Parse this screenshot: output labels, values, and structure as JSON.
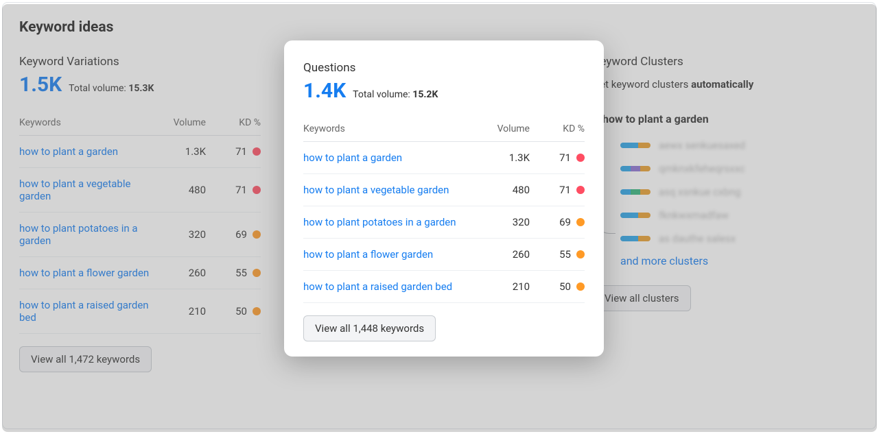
{
  "page_title": "Keyword ideas",
  "kd_colors": {
    "red": "#ff4d62",
    "orange": "#ff9a26"
  },
  "variations": {
    "title": "Keyword Variations",
    "count": "1.5K",
    "total_volume_label": "Total volume:",
    "total_volume": "15.3K",
    "headers": {
      "keywords": "Keywords",
      "volume": "Volume",
      "kd": "KD %"
    },
    "rows": [
      {
        "keyword": "how to plant a garden",
        "volume": "1.3K",
        "kd": "71",
        "kd_color": "red"
      },
      {
        "keyword": "how to plant a vegetable garden",
        "volume": "480",
        "kd": "71",
        "kd_color": "red"
      },
      {
        "keyword": "how to plant potatoes in a garden",
        "volume": "320",
        "kd": "69",
        "kd_color": "orange"
      },
      {
        "keyword": "how to plant a flower garden",
        "volume": "260",
        "kd": "55",
        "kd_color": "orange"
      },
      {
        "keyword": "how to plant a raised garden bed",
        "volume": "210",
        "kd": "50",
        "kd_color": "orange"
      }
    ],
    "button": "View all 1,472 keywords"
  },
  "questions": {
    "title": "Questions",
    "count": "1.4K",
    "total_volume_label": "Total volume:",
    "total_volume": "15.2K",
    "headers": {
      "keywords": "Keywords",
      "volume": "Volume",
      "kd": "KD %"
    },
    "rows": [
      {
        "keyword": "how to plant a garden",
        "volume": "1.3K",
        "kd": "71",
        "kd_color": "red"
      },
      {
        "keyword": "how to plant a vegetable garden",
        "volume": "480",
        "kd": "71",
        "kd_color": "red"
      },
      {
        "keyword": "how to plant potatoes in a garden",
        "volume": "320",
        "kd": "69",
        "kd_color": "orange"
      },
      {
        "keyword": "how to plant a flower garden",
        "volume": "260",
        "kd": "55",
        "kd_color": "orange"
      },
      {
        "keyword": "how to plant a raised garden bed",
        "volume": "210",
        "kd": "50",
        "kd_color": "orange"
      }
    ],
    "button": "View all 1,448 keywords"
  },
  "clusters": {
    "title": "Keyword Clusters",
    "subtitle_pre": "Get keyword clusters ",
    "subtitle_bold": "automatically",
    "root": "how to plant a garden",
    "items": [
      {
        "blur": "aewx senkuesaxed",
        "bar": [
          [
            "#2aa4e8",
            60
          ],
          [
            "#e79d2b",
            40
          ]
        ]
      },
      {
        "blur": "qmknxkfeheqrsxxc",
        "bar": [
          [
            "#2aa4e8",
            34
          ],
          [
            "#8a6fd1",
            33
          ],
          [
            "#e79d2b",
            33
          ]
        ]
      },
      {
        "blur": "asq xsnkue cxbng",
        "bar": [
          [
            "#2aa4e8",
            34
          ],
          [
            "#2fb37a",
            33
          ],
          [
            "#e79d2b",
            33
          ]
        ]
      },
      {
        "blur": "fknkwxmadfaw",
        "bar": [
          [
            "#2aa4e8",
            60
          ],
          [
            "#e79d2b",
            40
          ]
        ]
      },
      {
        "blur": "as dauthe salesx",
        "bar": [
          [
            "#2aa4e8",
            60
          ],
          [
            "#e79d2b",
            40
          ]
        ]
      }
    ],
    "more": "and more clusters",
    "button": "View all clusters"
  }
}
